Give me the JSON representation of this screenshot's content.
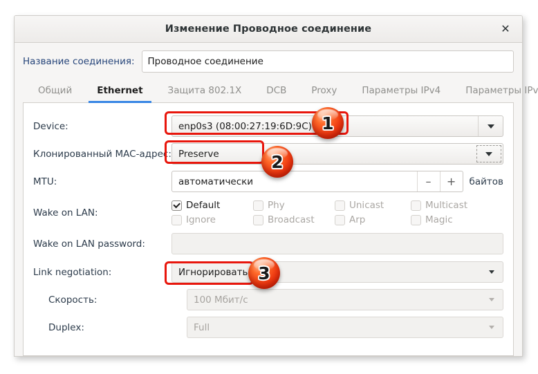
{
  "window": {
    "title": "Изменение Проводное соединение",
    "close_label": "✕"
  },
  "connection_name": {
    "label": "Название соединения:",
    "value": "Проводное соединение"
  },
  "tabs": [
    {
      "label": "Общий",
      "active": false
    },
    {
      "label": "Ethernet",
      "active": true
    },
    {
      "label": "Защита 802.1X",
      "active": false
    },
    {
      "label": "DCB",
      "active": false
    },
    {
      "label": "Proxy",
      "active": false
    },
    {
      "label": "Параметры IPv4",
      "active": false
    },
    {
      "label": "Параметры IPv6",
      "active": false
    }
  ],
  "form": {
    "device": {
      "label": "Device:",
      "value": "enp0s3 (08:00:27:19:6D:9C)"
    },
    "cloned_mac": {
      "label": "Клонированный MAC-адрес:",
      "value": "Preserve"
    },
    "mtu": {
      "label": "MTU:",
      "value": "автоматически",
      "minus": "–",
      "plus": "+",
      "units": "байтов"
    },
    "wake_on_lan": {
      "label": "Wake on LAN:",
      "options": [
        {
          "label": "Default",
          "checked": true,
          "enabled": true
        },
        {
          "label": "Phy",
          "checked": false,
          "enabled": false
        },
        {
          "label": "Unicast",
          "checked": false,
          "enabled": false
        },
        {
          "label": "Multicast",
          "checked": false,
          "enabled": false
        },
        {
          "label": "Ignore",
          "checked": false,
          "enabled": false
        },
        {
          "label": "Broadcast",
          "checked": false,
          "enabled": false
        },
        {
          "label": "Arp",
          "checked": false,
          "enabled": false
        },
        {
          "label": "Magic",
          "checked": false,
          "enabled": false
        }
      ]
    },
    "wol_password": {
      "label": "Wake on LAN password:",
      "value": ""
    },
    "link_negotiation": {
      "label": "Link negotiation:",
      "value": "Игнорировать"
    },
    "speed": {
      "label": "Скорость:",
      "value": "100 Мбит/с"
    },
    "duplex": {
      "label": "Duplex:",
      "value": "Full"
    }
  },
  "annotations": {
    "accent_color": "#e8160c",
    "badges": [
      {
        "number": "1"
      },
      {
        "number": "2"
      },
      {
        "number": "3"
      }
    ]
  }
}
